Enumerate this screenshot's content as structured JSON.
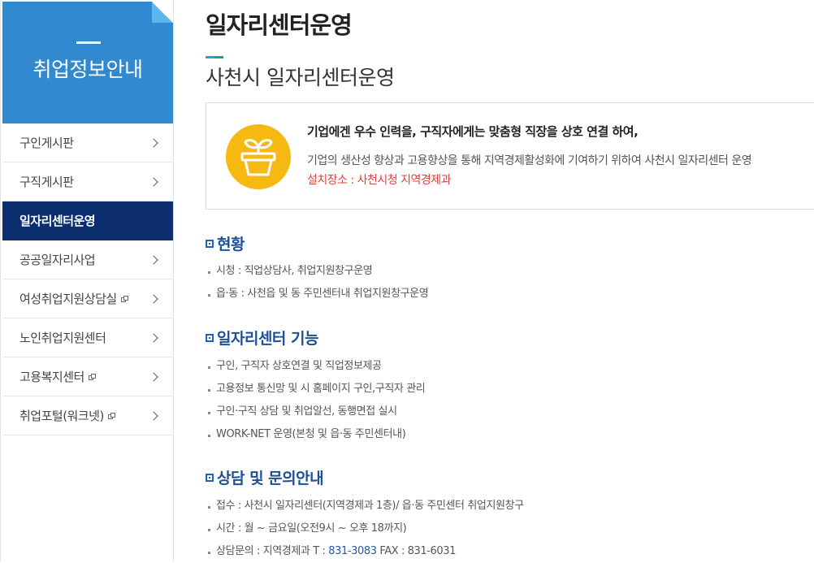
{
  "sidebar": {
    "title": "취업정보안내",
    "items": [
      {
        "label": "구인게시판",
        "active": false,
        "external": false
      },
      {
        "label": "구직게시판",
        "active": false,
        "external": false
      },
      {
        "label": "일자리센터운영",
        "active": true,
        "external": false
      },
      {
        "label": "공공일자리사업",
        "active": false,
        "external": false
      },
      {
        "label": "여성취업지원상담실",
        "active": false,
        "external": true
      },
      {
        "label": "노인취업지원센터",
        "active": false,
        "external": false
      },
      {
        "label": "고용복지센터",
        "active": false,
        "external": true
      },
      {
        "label": "취업포털(워크넷)",
        "active": false,
        "external": true
      }
    ],
    "header_color": "#3189cf",
    "active_color": "#0c2e6e"
  },
  "main": {
    "page_title": "일자리센터운영",
    "sub_title": "사천시 일자리센터운영",
    "intro": {
      "icon": "plant-pot-icon",
      "icon_color": "#f5b912",
      "lead": "기업에겐 우수 인력을, 구직자에게는 맞춤형 직장을 상호 연결 하여,",
      "desc": "기업의 생산성 향상과 고용향상을 통해 지역경제활성화에 기여하기 위하여 사천시 일자리센터 운영",
      "location": "설치장소 : 사천시청 지역경제과"
    },
    "sections": [
      {
        "heading": "현황",
        "items": [
          "시청 : 직업상담사, 취업지원창구운영",
          "읍·동 : 사천읍 및 동 주민센터내 취업지원창구운영"
        ]
      },
      {
        "heading": "일자리센터 기능",
        "items": [
          "구인, 구직자 상호연결 및 직업정보제공",
          "고용정보 통신망 및 시 홈페이지 구인,구직자 관리",
          "구인·구직 상담 및 취업알선, 동행면접 실시",
          "WORK-NET 운영(본청 및 읍·동 주민센터내)"
        ]
      },
      {
        "heading": "상담 및 문의안내",
        "items": [
          "접수 : 사천시 일자리센터(지역경제과 1층)/ 읍·동 주민센터 취업지원창구",
          "시간 : 월 ~ 금요일(오전9시 ~ 오후 18까지)"
        ],
        "contact": {
          "prefix": "상담문의 : 지역경제과 T : ",
          "tel": "831-3083",
          "fax_label": " FAX : ",
          "fax": "831-6031"
        }
      }
    ],
    "heading_color": "#1f4f95",
    "accent_red": "#e0413a"
  }
}
